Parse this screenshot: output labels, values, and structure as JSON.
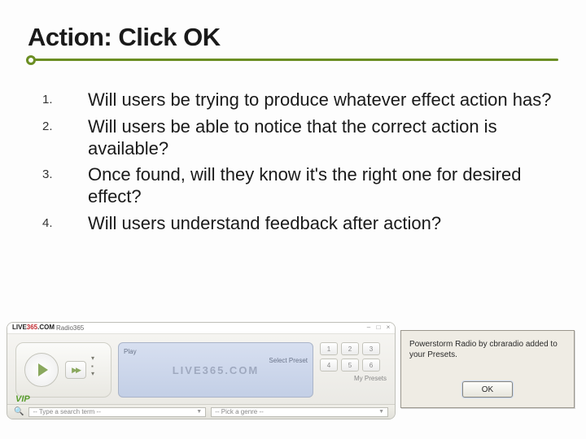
{
  "title": "Action: Click OK",
  "questions": [
    {
      "num": "1.",
      "text": "Will users be trying to produce whatever effect action has?"
    },
    {
      "num": "2.",
      "text": "Will users be able to notice that the correct action is available?"
    },
    {
      "num": "3.",
      "text": "Once found, will they know it's the right one for desired effect?"
    },
    {
      "num": "4.",
      "text": "Will users understand feedback after action?"
    }
  ],
  "player": {
    "brand_prefix": "LIVE",
    "brand_suffix": ".COM",
    "app_label": "Radio365",
    "play_label": "Play",
    "select_preset": "Select Preset",
    "watermark": "LIVE365.COM",
    "presets": [
      "1",
      "2",
      "3",
      "4",
      "5",
      "6"
    ],
    "my_presets": "My Presets",
    "vip": "VIP",
    "search_placeholder": "-- Type a search term --",
    "genre_placeholder": "-- Pick a genre --"
  },
  "dialog": {
    "message": "Powerstorm Radio by cbraradio added to your Presets.",
    "ok_label": "OK"
  }
}
